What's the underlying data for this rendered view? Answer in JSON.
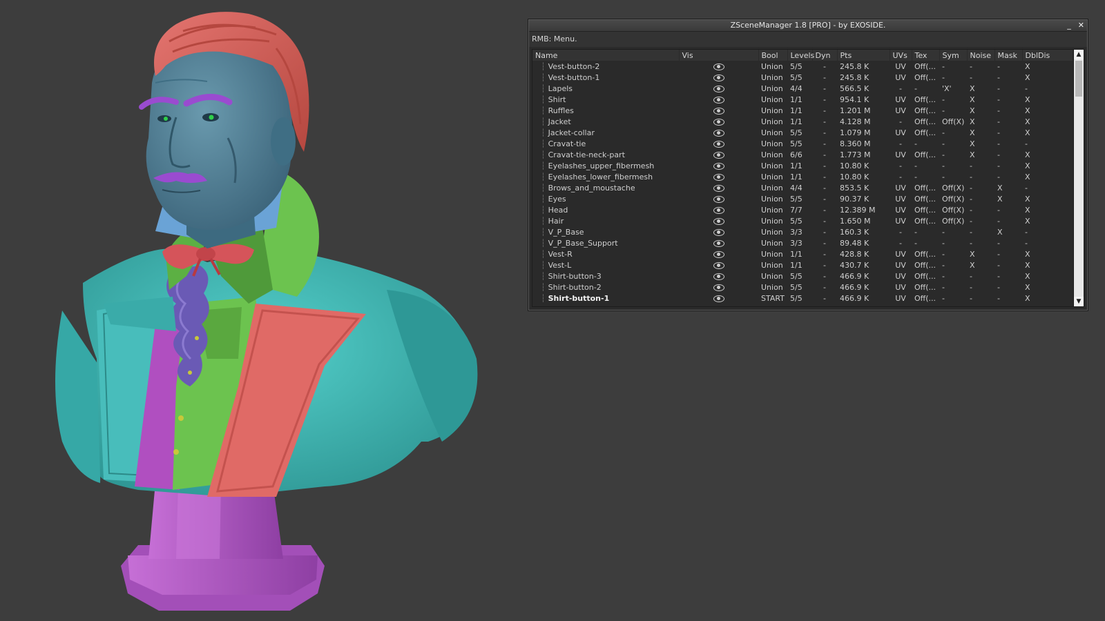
{
  "window": {
    "title": "ZSceneManager 1.8 [PRO]  -  by EXOSIDE.",
    "minimize_glyph": "_",
    "close_glyph": "✕",
    "hint": "RMB: Menu."
  },
  "columns": [
    "Name",
    "Vis",
    "Bool",
    "Levels",
    "Dyn",
    "Pts",
    "UVs",
    "Tex",
    "Sym",
    "Noise",
    "Mask",
    "DblDis"
  ],
  "rows": [
    {
      "name": "Vest-button-2",
      "bool": "Union",
      "levels": "5/5",
      "dyn": "-",
      "pts": "245.8 K",
      "uvs": "UV",
      "tex": "Off(...",
      "sym": "-",
      "noise": "-",
      "mask": "-",
      "dbldis": "X"
    },
    {
      "name": "Vest-button-1",
      "bool": "Union",
      "levels": "5/5",
      "dyn": "-",
      "pts": "245.8 K",
      "uvs": "UV",
      "tex": "Off(...",
      "sym": "-",
      "noise": "-",
      "mask": "-",
      "dbldis": "X"
    },
    {
      "name": "Lapels",
      "bool": "Union",
      "levels": "4/4",
      "dyn": "-",
      "pts": "566.5 K",
      "uvs": "-",
      "tex": "-",
      "sym": "'X'",
      "noise": "X",
      "mask": "-",
      "dbldis": "-"
    },
    {
      "name": "Shirt",
      "bool": "Union",
      "levels": "1/1",
      "dyn": "-",
      "pts": "954.1 K",
      "uvs": "UV",
      "tex": "Off(...",
      "sym": "-",
      "noise": "X",
      "mask": "-",
      "dbldis": "X"
    },
    {
      "name": "Ruffles",
      "bool": "Union",
      "levels": "1/1",
      "dyn": "-",
      "pts": "1.201 M",
      "uvs": "UV",
      "tex": "Off(...",
      "sym": "-",
      "noise": "X",
      "mask": "-",
      "dbldis": "X"
    },
    {
      "name": "Jacket",
      "bool": "Union",
      "levels": "1/1",
      "dyn": "-",
      "pts": "4.128 M",
      "uvs": "-",
      "tex": "Off(...",
      "sym": "Off(X)",
      "noise": "X",
      "mask": "-",
      "dbldis": "X"
    },
    {
      "name": "Jacket-collar",
      "bool": "Union",
      "levels": "5/5",
      "dyn": "-",
      "pts": "1.079 M",
      "uvs": "UV",
      "tex": "Off(...",
      "sym": "-",
      "noise": "X",
      "mask": "-",
      "dbldis": "X"
    },
    {
      "name": "Cravat-tie",
      "bool": "Union",
      "levels": "5/5",
      "dyn": "-",
      "pts": "8.360 M",
      "uvs": "-",
      "tex": "-",
      "sym": "-",
      "noise": "X",
      "mask": "-",
      "dbldis": "-"
    },
    {
      "name": "Cravat-tie-neck-part",
      "bool": "Union",
      "levels": "6/6",
      "dyn": "-",
      "pts": "1.773 M",
      "uvs": "UV",
      "tex": "Off(...",
      "sym": "-",
      "noise": "X",
      "mask": "-",
      "dbldis": "X"
    },
    {
      "name": "Eyelashes_upper_fibermesh",
      "bool": "Union",
      "levels": "1/1",
      "dyn": "-",
      "pts": "10.80 K",
      "uvs": "-",
      "tex": "-",
      "sym": "-",
      "noise": "-",
      "mask": "-",
      "dbldis": "X"
    },
    {
      "name": "Eyelashes_lower_fibermesh",
      "bool": "Union",
      "levels": "1/1",
      "dyn": "-",
      "pts": "10.80 K",
      "uvs": "-",
      "tex": "-",
      "sym": "-",
      "noise": "-",
      "mask": "-",
      "dbldis": "X"
    },
    {
      "name": "Brows_and_moustache",
      "bool": "Union",
      "levels": "4/4",
      "dyn": "-",
      "pts": "853.5 K",
      "uvs": "UV",
      "tex": "Off(...",
      "sym": "Off(X)",
      "noise": "-",
      "mask": "X",
      "dbldis": "-"
    },
    {
      "name": "Eyes",
      "bool": "Union",
      "levels": "5/5",
      "dyn": "-",
      "pts": "90.37 K",
      "uvs": "UV",
      "tex": "Off(...",
      "sym": "Off(X)",
      "noise": "-",
      "mask": "X",
      "dbldis": "X"
    },
    {
      "name": "Head",
      "bool": "Union",
      "levels": "7/7",
      "dyn": "-",
      "pts": "12.389 M",
      "uvs": "UV",
      "tex": "Off(...",
      "sym": "Off(X)",
      "noise": "-",
      "mask": "-",
      "dbldis": "X"
    },
    {
      "name": "Hair",
      "bool": "Union",
      "levels": "5/5",
      "dyn": "-",
      "pts": "1.650 M",
      "uvs": "UV",
      "tex": "Off(...",
      "sym": "Off(X)",
      "noise": "-",
      "mask": "-",
      "dbldis": "X"
    },
    {
      "name": "V_P_Base",
      "bool": "Union",
      "levels": "3/3",
      "dyn": "-",
      "pts": "160.3 K",
      "uvs": "-",
      "tex": "-",
      "sym": "-",
      "noise": "-",
      "mask": "X",
      "dbldis": "-"
    },
    {
      "name": "V_P_Base_Support",
      "bool": "Union",
      "levels": "3/3",
      "dyn": "-",
      "pts": "89.48 K",
      "uvs": "-",
      "tex": "-",
      "sym": "-",
      "noise": "-",
      "mask": "-",
      "dbldis": "-"
    },
    {
      "name": "Vest-R",
      "bool": "Union",
      "levels": "1/1",
      "dyn": "-",
      "pts": "428.8 K",
      "uvs": "UV",
      "tex": "Off(...",
      "sym": "-",
      "noise": "X",
      "mask": "-",
      "dbldis": "X"
    },
    {
      "name": "Vest-L",
      "bool": "Union",
      "levels": "1/1",
      "dyn": "-",
      "pts": "430.7 K",
      "uvs": "UV",
      "tex": "Off(...",
      "sym": "-",
      "noise": "X",
      "mask": "-",
      "dbldis": "X"
    },
    {
      "name": "Shirt-button-3",
      "bool": "Union",
      "levels": "5/5",
      "dyn": "-",
      "pts": "466.9 K",
      "uvs": "UV",
      "tex": "Off(...",
      "sym": "-",
      "noise": "-",
      "mask": "-",
      "dbldis": "X"
    },
    {
      "name": "Shirt-button-2",
      "bool": "Union",
      "levels": "5/5",
      "dyn": "-",
      "pts": "466.9 K",
      "uvs": "UV",
      "tex": "Off(...",
      "sym": "-",
      "noise": "-",
      "mask": "-",
      "dbldis": "X"
    },
    {
      "name": "Shirt-button-1",
      "bool": "START",
      "levels": "5/5",
      "dyn": "-",
      "pts": "466.9 K",
      "uvs": "UV",
      "tex": "Off(...",
      "sym": "-",
      "noise": "-",
      "mask": "-",
      "dbldis": "X",
      "active": true
    }
  ],
  "scroll": {
    "up_glyph": "▲",
    "down_glyph": "▼"
  },
  "colors": {
    "background": "#3d3d3d",
    "window_bg": "#2b2b2b",
    "hair": "#d9625d",
    "skin": "#4f7e95",
    "jacket": "#3fb7b4",
    "lapel": "#e06a66",
    "vest_green": "#6cc34f",
    "vest_purple": "#b04fc0",
    "ruffles": "#6a5ab5",
    "bowtie": "#d5545a",
    "base": "#b85cc8",
    "collar": "#6aa3d6"
  }
}
